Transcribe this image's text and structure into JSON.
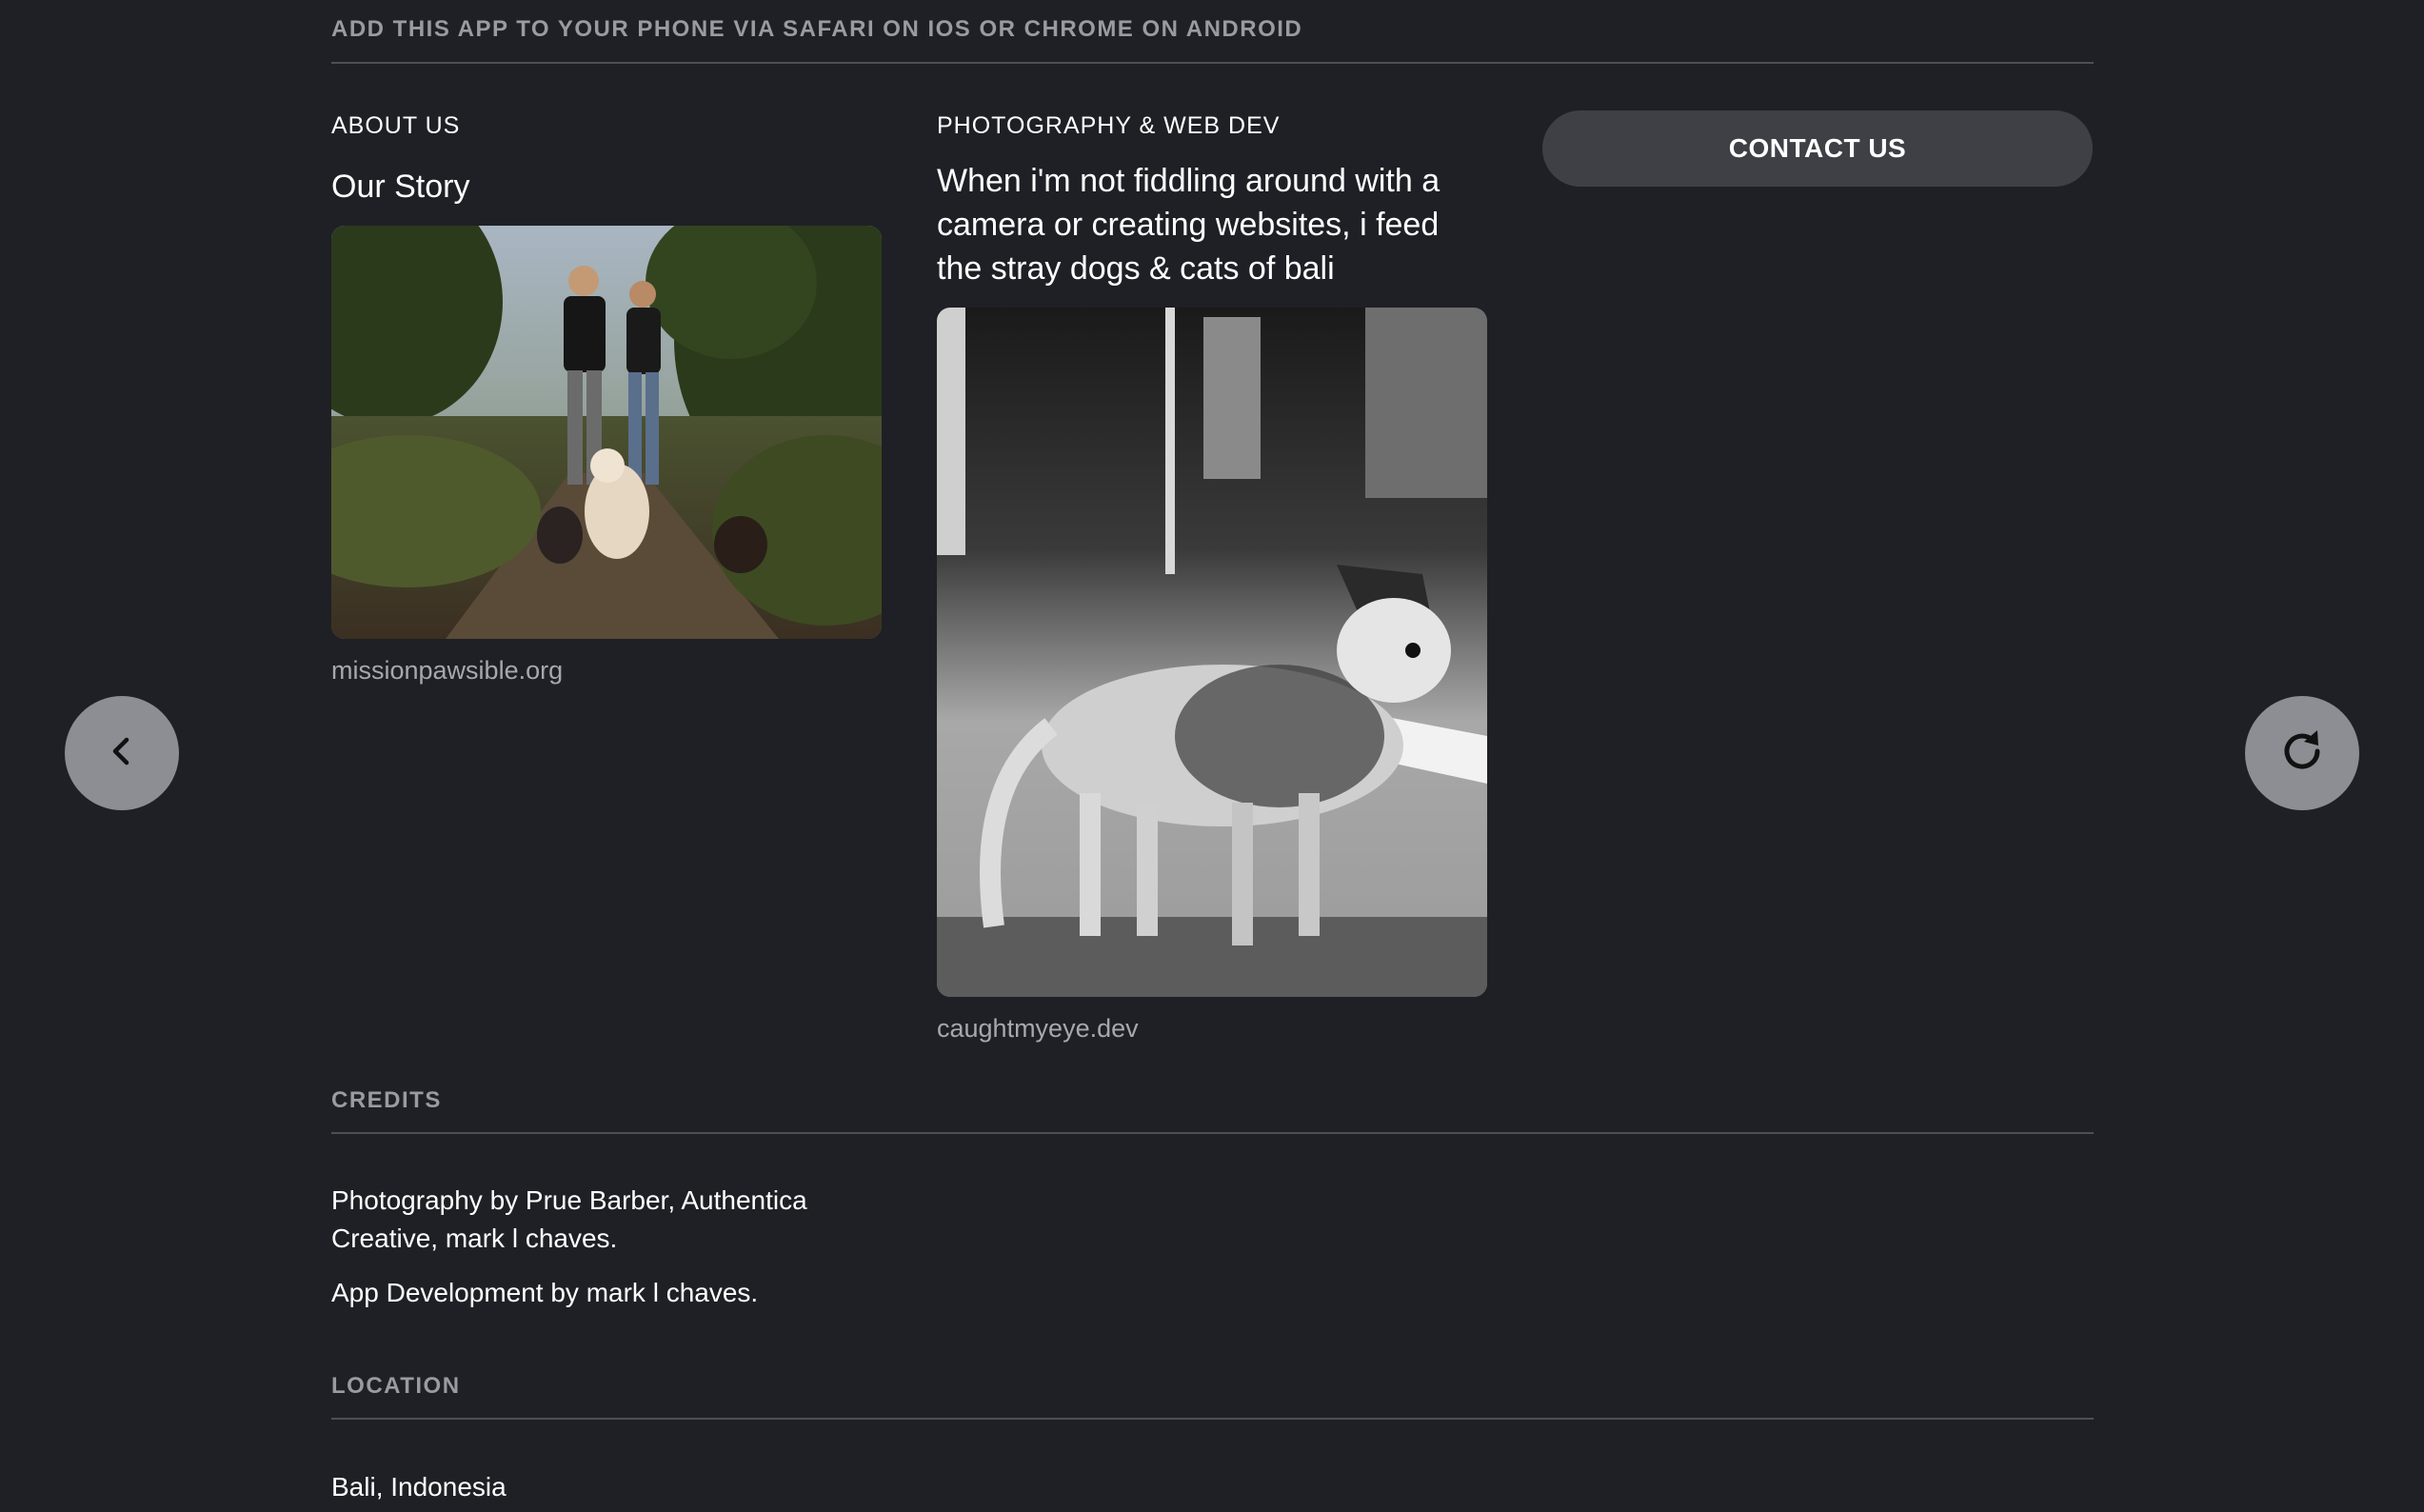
{
  "banner": {
    "text": "ADD THIS APP TO YOUR PHONE VIA SAFARI ON IOS OR CHROME ON ANDROID"
  },
  "about": {
    "kicker": "ABOUT US",
    "title": "Our Story",
    "link": "missionpawsible.org"
  },
  "photography": {
    "kicker": "PHOTOGRAPHY & WEB DEV",
    "title": "When i'm not fiddling around with a camera or creating websites, i feed the stray dogs & cats of bali",
    "link": "caughtmyeye.dev"
  },
  "contact": {
    "label": "CONTACT US"
  },
  "credits": {
    "header": "CREDITS",
    "photography": "Photography by Prue Barber, Authentica Creative, mark l chaves.",
    "development": "App Development by mark l chaves."
  },
  "location": {
    "header": "LOCATION",
    "value": "Bali, Indonesia"
  },
  "nav": {
    "back_icon": "chevron-left-icon",
    "refresh_icon": "refresh-icon"
  },
  "colors": {
    "background": "#1f2026",
    "button": "#3f4046",
    "round_button": "#8d8e93",
    "muted_text": "#9a9ba0"
  }
}
